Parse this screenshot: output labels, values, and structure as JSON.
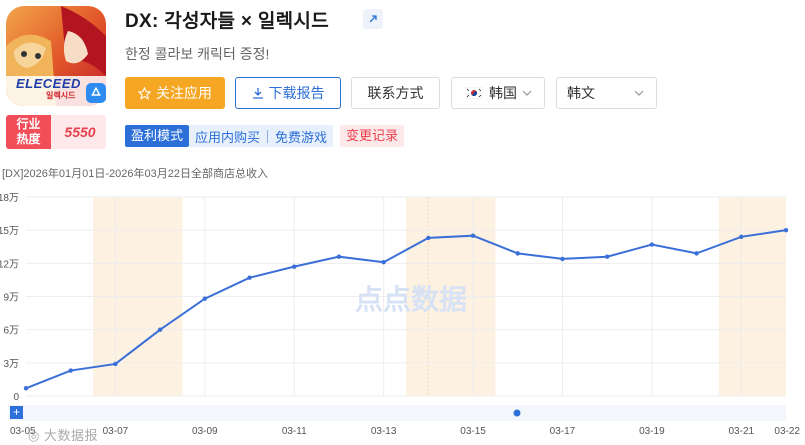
{
  "app": {
    "title": "DX: 각성자들 × 일렉시드",
    "subtitle": "한정 콜라보 캐릭터 증정!",
    "icon_name": "app-icon-eleceed",
    "icon_text": "ELECEED",
    "icon_subtext": "일렉시드"
  },
  "actions": {
    "follow_label": "关注应用",
    "report_label": "下载报告",
    "contact_label": "联系方式"
  },
  "filters": {
    "country": "韩国",
    "language": "韩文"
  },
  "heat": {
    "label_line1": "行业",
    "label_line2": "热度",
    "value": "5550"
  },
  "tags": {
    "model": "盈利模式",
    "iap": "应用内购买",
    "free": "免费游戏",
    "change_log": "变更记录"
  },
  "chart_caption": "[DX]2026年01月01日-2026年03月22日全部商店总收入",
  "watermark": "大数据报",
  "chart_watermark": "点点数据",
  "colors": {
    "accent_orange": "#f5a623",
    "brand_blue": "#2c6fd8",
    "line_blue": "#3a6fd8",
    "heat_red": "#f24e5a",
    "weekend_band": "#fdf1e2"
  },
  "chart_data": {
    "type": "line",
    "title": "[DX]2026年01月01日-2026年03月22日全部商店总收入",
    "xlabel": "",
    "ylabel": "",
    "ylim": [
      0,
      180000
    ],
    "y_ticks": [
      "0",
      "3万",
      "6万",
      "9万",
      "12万",
      "15万",
      "18万"
    ],
    "x_ticks": [
      "03-05",
      "03-07",
      "03-09",
      "03-11",
      "03-13",
      "03-15",
      "03-17",
      "03-19",
      "03-21",
      "03-22"
    ],
    "x": [
      "03-05",
      "03-06",
      "03-07",
      "03-08",
      "03-09",
      "03-10",
      "03-11",
      "03-12",
      "03-13",
      "03-14",
      "03-15",
      "03-16",
      "03-17",
      "03-18",
      "03-19",
      "03-20",
      "03-21",
      "03-22"
    ],
    "series": [
      {
        "values": [
          7000,
          23000,
          29000,
          60000,
          88000,
          107000,
          117000,
          126000,
          121000,
          143000,
          145000,
          129000,
          124000,
          126000,
          137000,
          129000,
          144000,
          150000
        ]
      }
    ],
    "weekend_bands": [
      [
        "03-07",
        "03-08"
      ],
      [
        "03-14",
        "03-15"
      ],
      [
        "03-21",
        "03-22"
      ]
    ],
    "grid": true,
    "legend": "none"
  }
}
